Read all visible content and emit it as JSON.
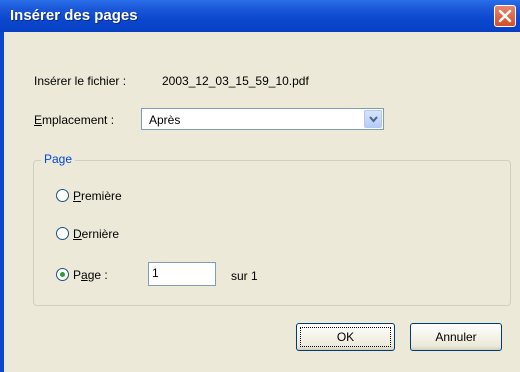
{
  "window": {
    "title": "Insérer des pages"
  },
  "file": {
    "label": "Insérer le fichier :",
    "value": "2003_12_03_15_59_10.pdf"
  },
  "location": {
    "label": "Emplacement :",
    "selected": "Après"
  },
  "page_group": {
    "title": "Page",
    "options": {
      "first": "Première",
      "last": "Dernière",
      "page": "Page :"
    },
    "selected": "page",
    "page_number": "1",
    "page_total": "sur 1"
  },
  "buttons": {
    "ok": "OK",
    "cancel": "Annuler"
  }
}
